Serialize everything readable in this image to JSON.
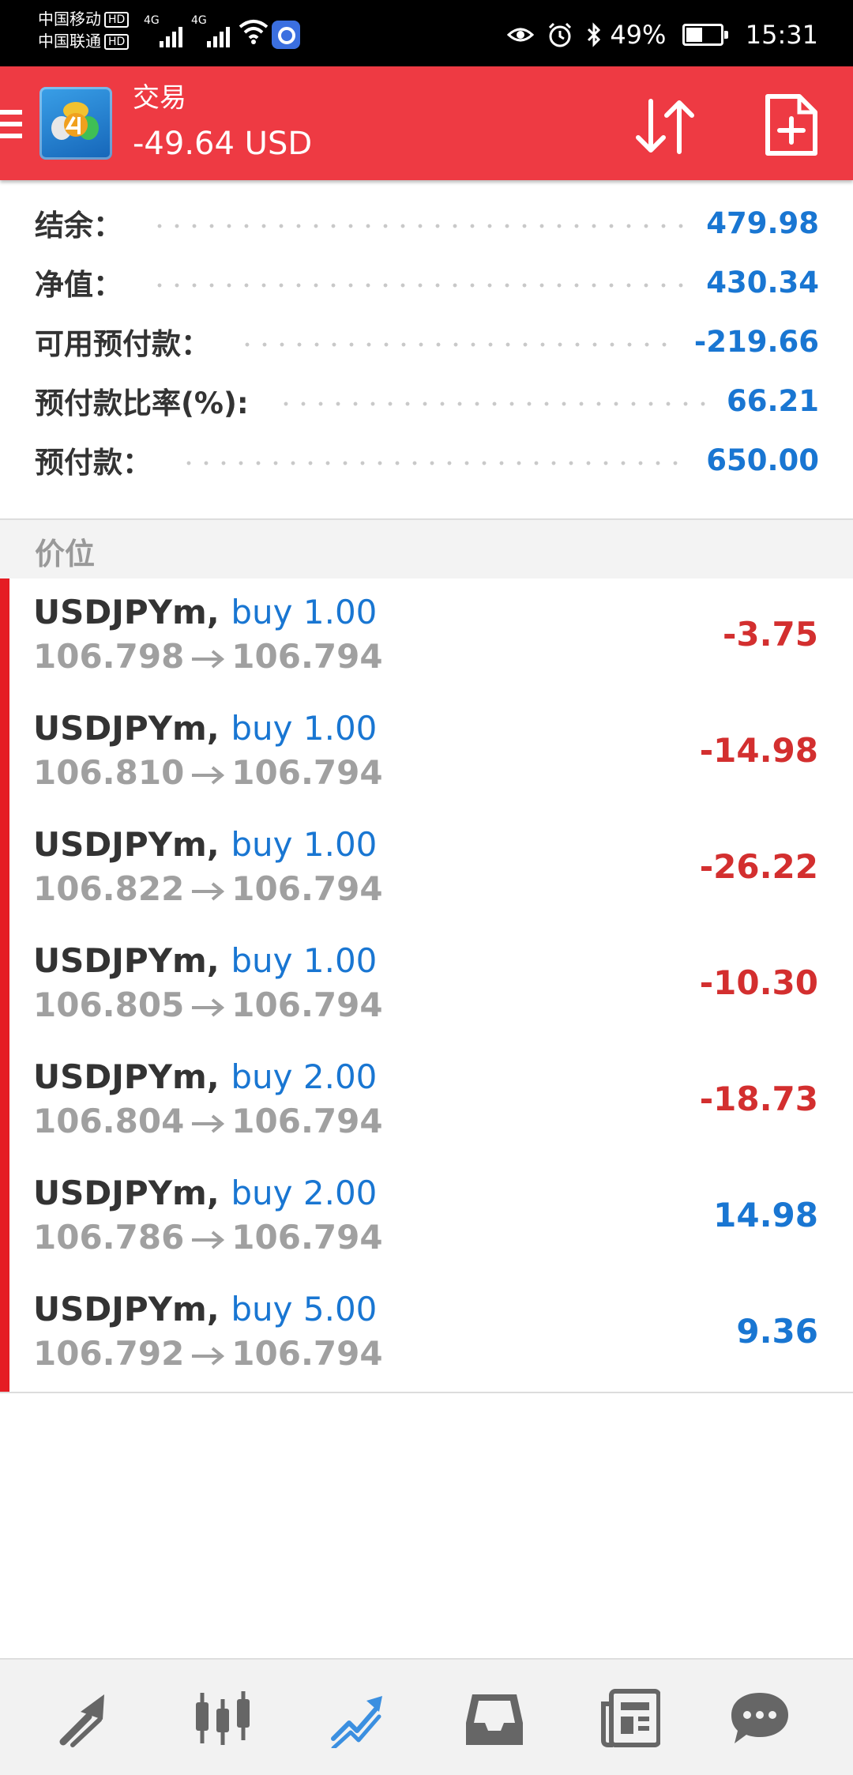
{
  "status_bar": {
    "carrier1": "中国移动",
    "carrier2": "中国联通",
    "hd": "HD",
    "net1": "4G",
    "net2": "4G",
    "battery": "49%",
    "time": "15:31"
  },
  "header": {
    "title": "交易",
    "profit": "-49.64 USD",
    "icons": [
      "menu-icon",
      "metatrader-logo",
      "sort-arrows-icon",
      "new-order-icon"
    ]
  },
  "summary": [
    {
      "label": "结余：",
      "value": "479.98"
    },
    {
      "label": "净值：",
      "value": "430.34"
    },
    {
      "label": "可用预付款：",
      "value": "-219.66"
    },
    {
      "label": "预付款比率(%):",
      "value": "66.21"
    },
    {
      "label": "预付款：",
      "value": "650.00"
    }
  ],
  "section": {
    "title": "价位"
  },
  "positions": [
    {
      "symbol": "USDJPYm,",
      "type": "buy 1.00",
      "open": "106.798",
      "current": "106.794",
      "profit": "-3.75",
      "negative": true
    },
    {
      "symbol": "USDJPYm,",
      "type": "buy 1.00",
      "open": "106.810",
      "current": "106.794",
      "profit": "-14.98",
      "negative": true
    },
    {
      "symbol": "USDJPYm,",
      "type": "buy 1.00",
      "open": "106.822",
      "current": "106.794",
      "profit": "-26.22",
      "negative": true
    },
    {
      "symbol": "USDJPYm,",
      "type": "buy 1.00",
      "open": "106.805",
      "current": "106.794",
      "profit": "-10.30",
      "negative": true
    },
    {
      "symbol": "USDJPYm,",
      "type": "buy 2.00",
      "open": "106.804",
      "current": "106.794",
      "profit": "-18.73",
      "negative": true
    },
    {
      "symbol": "USDJPYm,",
      "type": "buy 2.00",
      "open": "106.786",
      "current": "106.794",
      "profit": "14.98",
      "negative": false
    },
    {
      "symbol": "USDJPYm,",
      "type": "buy 5.00",
      "open": "106.792",
      "current": "106.794",
      "profit": "9.36",
      "negative": false
    }
  ],
  "bottom_nav": [
    "quotes-icon",
    "chart-candles-icon",
    "trade-icon",
    "history-inbox-icon",
    "news-icon",
    "chat-icon"
  ],
  "colors": {
    "header_bg": "#ee3a43",
    "accent_blue": "#1976d2",
    "loss_red": "#d32f2f",
    "row_marker": "#e51c23"
  }
}
